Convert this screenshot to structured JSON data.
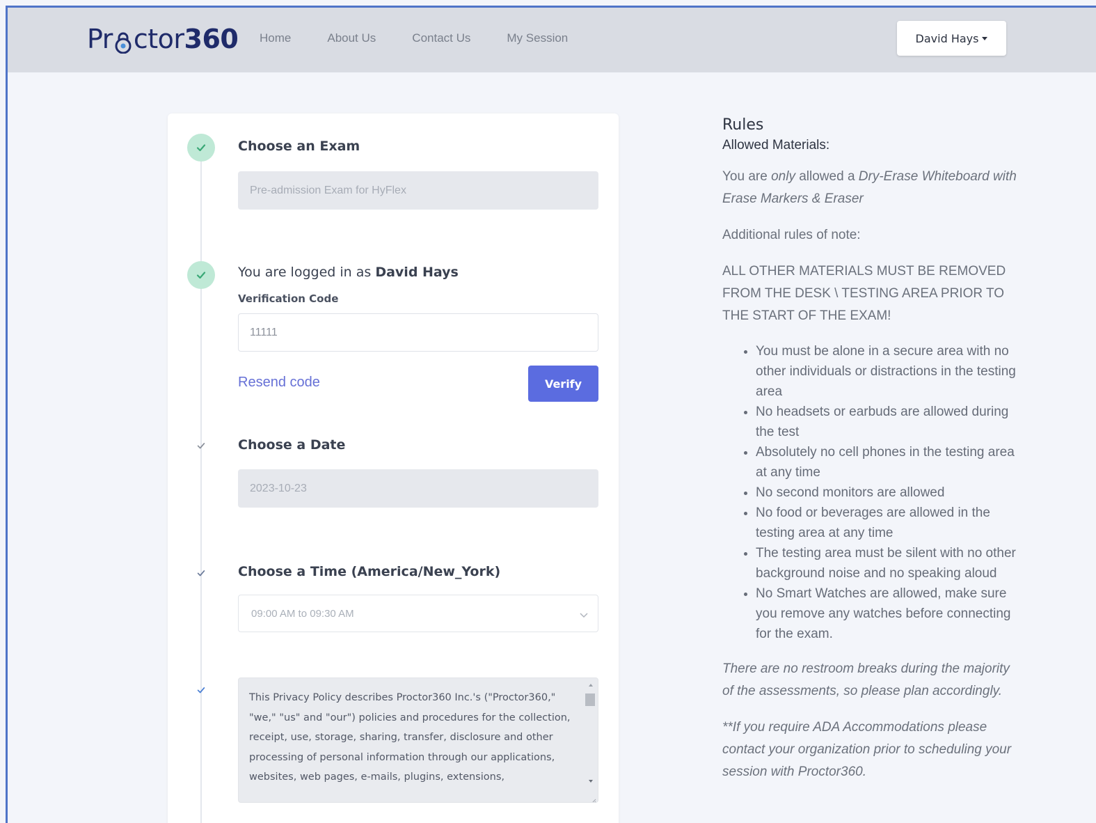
{
  "navbar": {
    "logo_pre": "Pr",
    "logo_mid": "ctor",
    "logo_num": "360",
    "links": [
      "Home",
      "About Us",
      "Contact Us",
      "My Session"
    ],
    "user_name": "David Hays"
  },
  "steps": {
    "exam": {
      "title": "Choose an Exam",
      "value": "Pre-admission Exam for HyFlex"
    },
    "login": {
      "title_prefix": "You are logged in as",
      "title_name": "David Hays",
      "code_label": "Verification Code",
      "code_value": "11111",
      "resend_label": "Resend code",
      "verify_label": "Verify"
    },
    "date": {
      "title": "Choose a Date",
      "value": "2023-10-23"
    },
    "time": {
      "title": "Choose a Time (America/New_York)",
      "selected": "09:00 AM to 09:30 AM"
    },
    "privacy": {
      "text": "This Privacy Policy describes Proctor360 Inc.'s (\"Proctor360,\" \"we,\" \"us\" and \"our\") policies and procedures for the collection, receipt, use, storage, sharing, transfer, disclosure and other processing of personal information through our applications, websites, web pages, e-mails, plugins, extensions,"
    }
  },
  "rules": {
    "title": "Rules",
    "allowed_heading": "Allowed Materials:",
    "allowed_pre": "You are",
    "allowed_only": "only",
    "allowed_mid": "allowed a",
    "allowed_item": "Dry-Erase Whiteboard with Erase Markers & Eraser",
    "additional": "Additional rules of note:",
    "caps_notice": "ALL OTHER MATERIALS MUST BE REMOVED FROM THE DESK \\ TESTING AREA PRIOR TO THE START OF THE EXAM!",
    "list": [
      "You must be alone in a secure area with no other individuals or distractions in the testing area",
      "No headsets or earbuds are allowed during the test",
      "Absolutely no cell phones in the testing area at any time",
      "No second monitors are allowed",
      "No food or beverages are allowed in the testing area at any time",
      "The testing area must be silent with no other background noise and no speaking aloud",
      "No Smart Watches are allowed, make sure you remove any watches before connecting for the exam."
    ],
    "restroom": "There are no restroom breaks during the majority of the assessments, so please plan accordingly.",
    "ada": "**If you require ADA Accommodations please contact your organization prior to scheduling your session with Proctor360."
  },
  "colors": {
    "accent": "#5b6ce0",
    "brand": "#1f2b6a",
    "success": "#bfe9d6",
    "frame": "#4f74c8"
  }
}
